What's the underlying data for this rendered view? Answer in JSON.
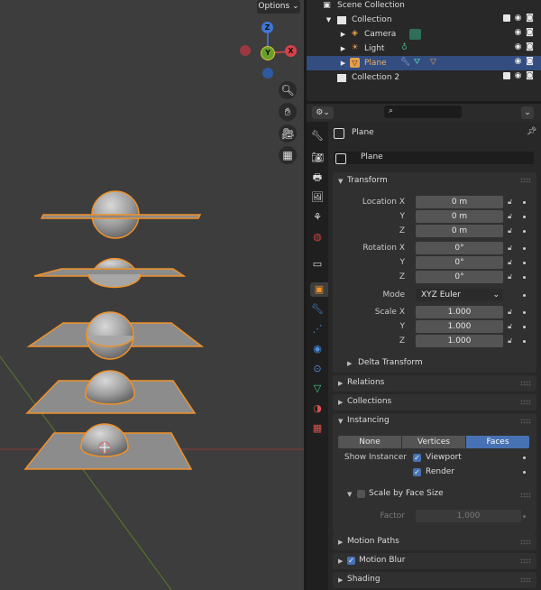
{
  "viewport": {
    "options_label": "Options",
    "options_chevron": "⌄",
    "gizmo": {
      "z": "Z",
      "y": "Y",
      "x": "X"
    },
    "nav_icons": [
      "zoom-icon",
      "hand-pan-icon",
      "camera-icon",
      "grid-icon"
    ]
  },
  "outliner": {
    "rows": [
      {
        "label": "Scene Collection",
        "icon": "scene-collection-icon"
      },
      {
        "label": "Collection",
        "icon": "collection-icon"
      },
      {
        "label": "Camera",
        "icon": "camera-object-icon"
      },
      {
        "label": "Light",
        "icon": "light-object-icon"
      },
      {
        "label": "Plane",
        "icon": "mesh-object-icon"
      },
      {
        "label": "Collection 2",
        "icon": "collection-icon"
      }
    ]
  },
  "properties": {
    "header_object": "Plane",
    "name_field": "Plane",
    "transform": {
      "title": "Transform",
      "location_label": "Location X",
      "rotation_label": "Rotation X",
      "scale_label": "Scale X",
      "y_label": "Y",
      "z_label": "Z",
      "location": [
        "0 m",
        "0 m",
        "0 m"
      ],
      "rotation": [
        "0°",
        "0°",
        "0°"
      ],
      "scale": [
        "1.000",
        "1.000",
        "1.000"
      ],
      "mode_label": "Mode",
      "mode_value": "XYZ Euler",
      "delta_label": "Delta Transform"
    },
    "relations_title": "Relations",
    "collections_title": "Collections",
    "instancing": {
      "title": "Instancing",
      "options": [
        "None",
        "Vertices",
        "Faces"
      ],
      "selected": "Faces",
      "show_instancer_label": "Show Instancer",
      "viewport_label": "Viewport",
      "render_label": "Render",
      "scale_by_face_label": "Scale by Face Size",
      "factor_label": "Factor",
      "factor_value": "1.000"
    },
    "motion_paths_title": "Motion Paths",
    "motion_blur_title": "Motion Blur",
    "shading_title": "Shading"
  },
  "colors": {
    "accent_blue": "#4772b3",
    "selection_orange": "#f0922a",
    "outliner_selected": "#334d80"
  }
}
